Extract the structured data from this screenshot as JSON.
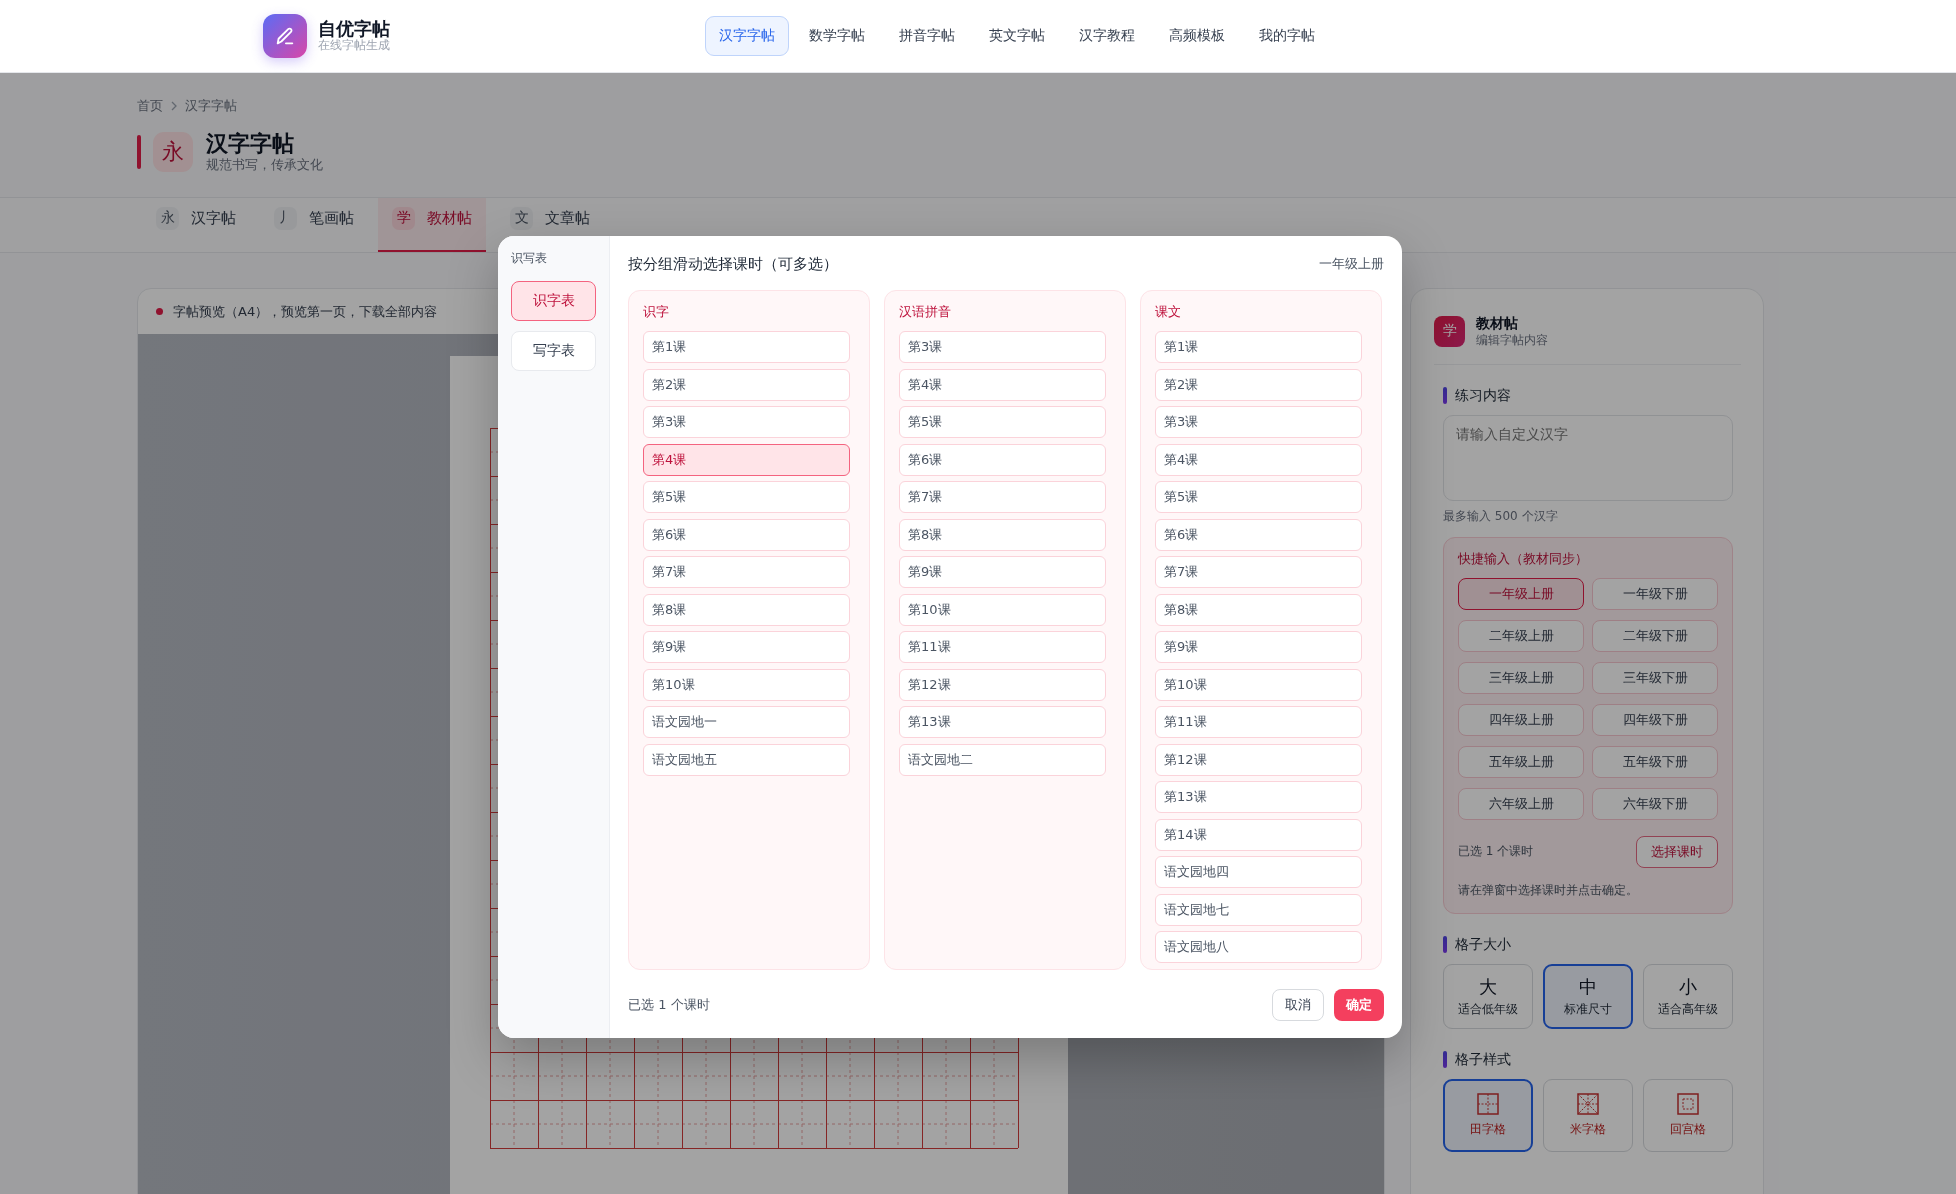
{
  "header": {
    "logo_title": "自优字帖",
    "logo_subtitle": "在线字帖生成"
  },
  "nav": [
    {
      "label": "汉字字帖",
      "selected": true
    },
    {
      "label": "数学字帖",
      "selected": false
    },
    {
      "label": "拼音字帖",
      "selected": false
    },
    {
      "label": "英文字帖",
      "selected": false
    },
    {
      "label": "汉字教程",
      "selected": false
    },
    {
      "label": "高频模板",
      "selected": false
    },
    {
      "label": "我的字帖",
      "selected": false
    }
  ],
  "breadcrumb": [
    "首页",
    "汉字字帖"
  ],
  "page_header": {
    "icon_char": "永",
    "title": "汉字字帖",
    "subtitle": "规范书写，传承文化"
  },
  "tabs": [
    {
      "icon_char": "永",
      "label": "汉字帖",
      "selected": false
    },
    {
      "icon_char": "丿",
      "label": "笔画帖",
      "selected": false
    },
    {
      "icon_char": "学",
      "label": "教材帖",
      "selected": true
    },
    {
      "icon_char": "文",
      "label": "文章帖",
      "selected": false
    }
  ],
  "preview": {
    "notice": "字帖预览（A4），预览第一页，下载全部内容"
  },
  "side_panel": {
    "icon_char": "学",
    "title": "教材帖",
    "subtitle": "编辑字帖内容",
    "practice": {
      "heading": "练习内容",
      "placeholder": "请输入自定义汉字",
      "hint": "最多输入 500 个汉字"
    },
    "quick_input": {
      "heading": "快捷输入（教材同步）",
      "grades": [
        {
          "label": "一年级上册",
          "selected": true
        },
        {
          "label": "一年级下册",
          "selected": false
        },
        {
          "label": "二年级上册",
          "selected": false
        },
        {
          "label": "二年级下册",
          "selected": false
        },
        {
          "label": "三年级上册",
          "selected": false
        },
        {
          "label": "三年级下册",
          "selected": false
        },
        {
          "label": "四年级上册",
          "selected": false
        },
        {
          "label": "四年级下册",
          "selected": false
        },
        {
          "label": "五年级上册",
          "selected": false
        },
        {
          "label": "五年级下册",
          "selected": false
        },
        {
          "label": "六年级上册",
          "selected": false
        },
        {
          "label": "六年级下册",
          "selected": false
        }
      ],
      "selected_count": "已选 1 个课时",
      "choose_button": "选择课时",
      "hint": "请在弹窗中选择课时并点击确定。"
    },
    "grid_size": {
      "heading": "格子大小",
      "options": [
        {
          "char": "大",
          "label": "适合低年级",
          "selected": false
        },
        {
          "char": "中",
          "label": "标准尺寸",
          "selected": true
        },
        {
          "char": "小",
          "label": "适合高年级",
          "selected": false
        }
      ]
    },
    "grid_style": {
      "heading": "格子样式",
      "options": [
        {
          "kind": "tian",
          "label": "田字格",
          "selected": true
        },
        {
          "kind": "mi",
          "label": "米字格",
          "selected": false
        },
        {
          "kind": "hui",
          "label": "回宫格",
          "selected": false
        }
      ]
    }
  },
  "modal": {
    "sidebar": {
      "heading": "识写表",
      "items": [
        {
          "label": "识字表",
          "selected": true
        },
        {
          "label": "写字表",
          "selected": false
        }
      ]
    },
    "title": "按分组滑动选择课时（可多选）",
    "grade": "一年级上册",
    "groups": [
      {
        "title": "识字",
        "lessons": [
          {
            "label": "第1课",
            "selected": false
          },
          {
            "label": "第2课",
            "selected": false
          },
          {
            "label": "第3课",
            "selected": false
          },
          {
            "label": "第4课",
            "selected": true
          },
          {
            "label": "第5课",
            "selected": false
          },
          {
            "label": "第6课",
            "selected": false
          },
          {
            "label": "第7课",
            "selected": false
          },
          {
            "label": "第8课",
            "selected": false
          },
          {
            "label": "第9课",
            "selected": false
          },
          {
            "label": "第10课",
            "selected": false
          },
          {
            "label": "语文园地一",
            "selected": false
          },
          {
            "label": "语文园地五",
            "selected": false
          }
        ]
      },
      {
        "title": "汉语拼音",
        "lessons": [
          {
            "label": "第3课",
            "selected": false
          },
          {
            "label": "第4课",
            "selected": false
          },
          {
            "label": "第5课",
            "selected": false
          },
          {
            "label": "第6课",
            "selected": false
          },
          {
            "label": "第7课",
            "selected": false
          },
          {
            "label": "第8课",
            "selected": false
          },
          {
            "label": "第9课",
            "selected": false
          },
          {
            "label": "第10课",
            "selected": false
          },
          {
            "label": "第11课",
            "selected": false
          },
          {
            "label": "第12课",
            "selected": false
          },
          {
            "label": "第13课",
            "selected": false
          },
          {
            "label": "语文园地二",
            "selected": false
          }
        ]
      },
      {
        "title": "课文",
        "lessons": [
          {
            "label": "第1课",
            "selected": false
          },
          {
            "label": "第2课",
            "selected": false
          },
          {
            "label": "第3课",
            "selected": false
          },
          {
            "label": "第4课",
            "selected": false
          },
          {
            "label": "第5课",
            "selected": false
          },
          {
            "label": "第6课",
            "selected": false
          },
          {
            "label": "第7课",
            "selected": false
          },
          {
            "label": "第8课",
            "selected": false
          },
          {
            "label": "第9课",
            "selected": false
          },
          {
            "label": "第10课",
            "selected": false
          },
          {
            "label": "第11课",
            "selected": false
          },
          {
            "label": "第12课",
            "selected": false
          },
          {
            "label": "第13课",
            "selected": false
          },
          {
            "label": "第14课",
            "selected": false
          },
          {
            "label": "语文园地四",
            "selected": false
          },
          {
            "label": "语文园地七",
            "selected": false
          },
          {
            "label": "语文园地八",
            "selected": false
          }
        ]
      }
    ],
    "footer": {
      "count": "已选 1 个课时",
      "cancel": "取消",
      "confirm": "确定"
    }
  }
}
